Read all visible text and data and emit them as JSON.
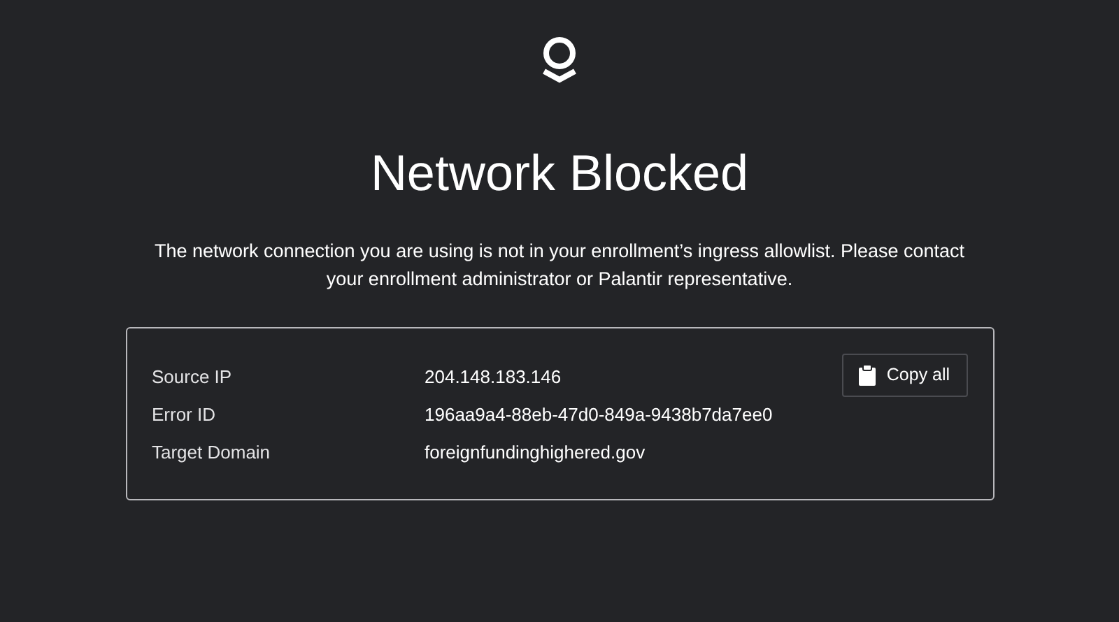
{
  "title": "Network Blocked",
  "message": "The network connection you are using is not in your enrollment’s ingress allowlist. Please contact your enrollment administrator or Palantir representative.",
  "details": [
    {
      "label": "Source IP",
      "value": "204.148.183.146"
    },
    {
      "label": "Error ID",
      "value": "196aa9a4-88eb-47d0-849a-9438b7da7ee0"
    },
    {
      "label": "Target Domain",
      "value": "foreignfundinghighered.gov"
    }
  ],
  "copy_button": {
    "label": "Copy all"
  }
}
